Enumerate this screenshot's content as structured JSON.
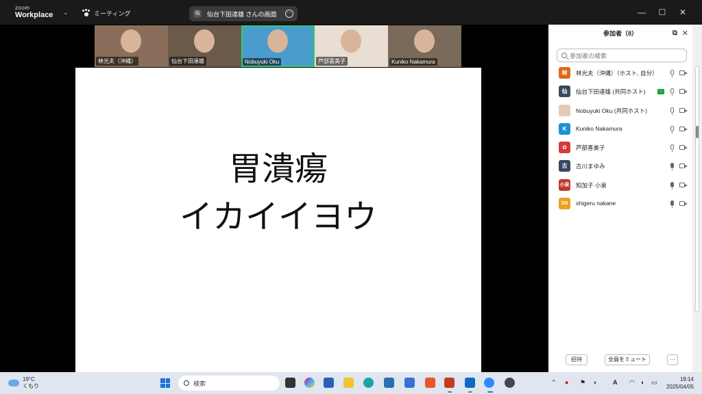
{
  "titlebar": {
    "brand_top": "zoom",
    "brand_bottom": "Workplace",
    "meeting_label": "ミーティング",
    "share_owner_icon": "仙",
    "share_label": "仙台下田達雄 さんの画面",
    "more": "···",
    "minimize": "—",
    "maximize": "☐",
    "close": "✕"
  },
  "video_strip": [
    {
      "name": "林光夫（沖縄）",
      "bg": "#8a6d5a"
    },
    {
      "name": "仙台下田達雄",
      "bg": "#6b5a4a"
    },
    {
      "name": "Nobuyuki Oku",
      "bg": "#4a9ccc"
    },
    {
      "name": "芦部喜美子",
      "bg": "#e9ded3"
    },
    {
      "name": "Kuniko Nakamura",
      "bg": "#7a6a5a"
    }
  ],
  "slide": {
    "line1": "胃潰瘍",
    "line2": "イカイイヨウ"
  },
  "panel": {
    "title": "参加者（8）",
    "popout": "⧉",
    "close": "✕",
    "search_placeholder": "参加者の検索",
    "participants": [
      {
        "avatar": "林",
        "color": "#e0661a",
        "name": "林光夫（沖縄）（ホスト, 自分）",
        "mic": "outline"
      },
      {
        "avatar": "仙",
        "color": "#3a4a5e",
        "name": "仙台下田達雄 (共同ホスト)",
        "mic": "outline",
        "sharing": true
      },
      {
        "avatar": "",
        "color": "#e7c9b4",
        "name": "Nobuyuki Oku (共同ホスト)",
        "mic": "outline"
      },
      {
        "avatar": "K",
        "color": "#1f8fd6",
        "name": "Kuniko Nakamura",
        "mic": "outline"
      },
      {
        "avatar": "✿",
        "color": "#d93a3a",
        "name": "芦部喜美子",
        "mic": "outline"
      },
      {
        "avatar": "古",
        "color": "#34495e",
        "name": "古川まゆみ",
        "mic": "filled"
      },
      {
        "avatar": "小泉",
        "color": "#c0392b",
        "name": "知加子 小泉",
        "mic": "filled"
      },
      {
        "avatar": "SN",
        "color": "#f0a020",
        "name": "shigeru nakane",
        "mic": "filled"
      }
    ],
    "invite": "招待",
    "mute_all": "全員をミュート",
    "more": "···"
  },
  "taskbar": {
    "temp": "19°C",
    "weather": "くもり",
    "search": "検索",
    "time": "19:14",
    "date": "2025/04/05",
    "tray_ime": "A"
  }
}
